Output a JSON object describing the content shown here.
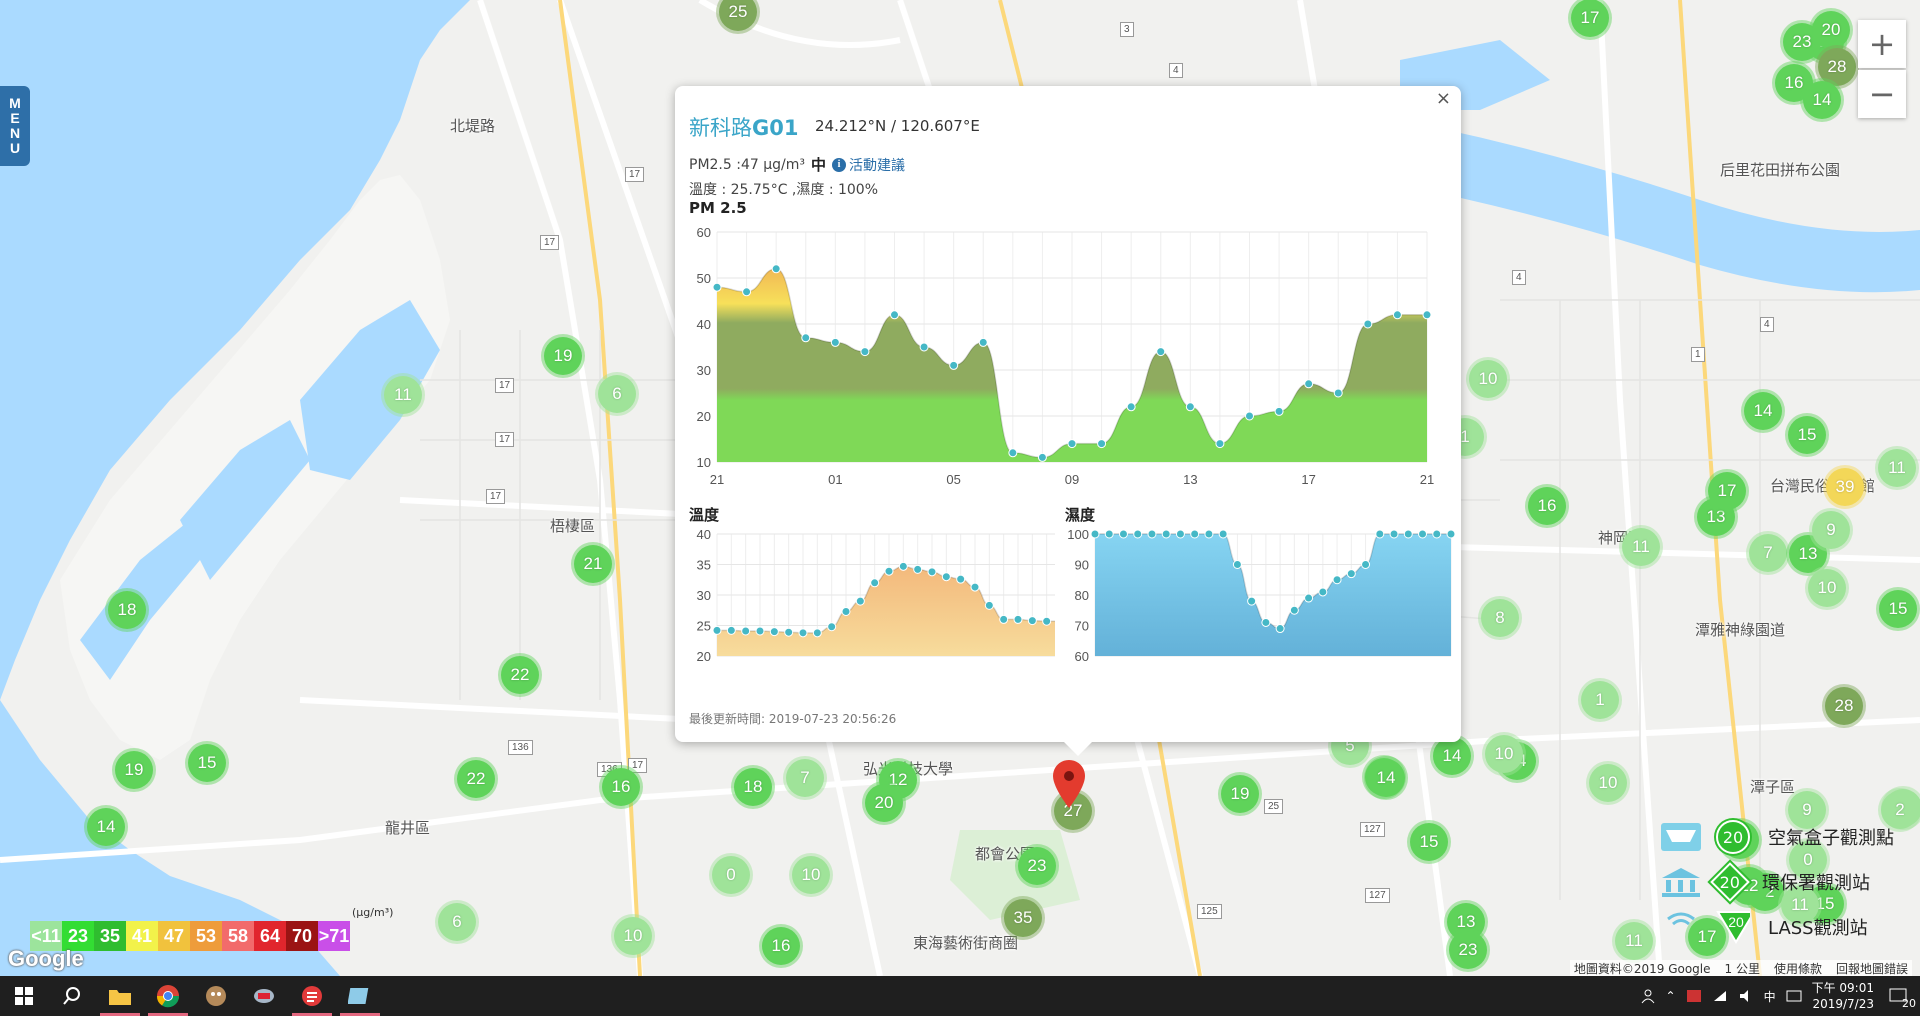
{
  "popup": {
    "station_name_prefix": "新科路",
    "station_name_code": "G01",
    "coords": "24.212°N / 120.607°E",
    "close": "×",
    "pm_reading": "PM2.5 :47 μg/m³",
    "pm_level": "中",
    "advice_link": "活動建議",
    "info_glyph": "i",
    "temp_humidity": "溫度 : 25.75°C ,濕度 : 100%",
    "pm_chart_title": "PM 2.5",
    "temp_chart_title": "溫度",
    "hum_chart_title": "濕度",
    "last_updated": "最後更新時間: 2019-07-23 20:56:26"
  },
  "chart_data": [
    {
      "type": "area",
      "title": "PM 2.5",
      "x_ticks": [
        "21",
        "01",
        "05",
        "09",
        "13",
        "17",
        "21"
      ],
      "ylim": [
        10,
        60
      ],
      "y_ticks": [
        10,
        20,
        30,
        40,
        50,
        60
      ],
      "values": [
        48,
        47,
        52,
        37,
        36,
        34,
        42,
        35,
        31,
        36,
        12,
        11,
        14,
        14,
        22,
        34,
        22,
        14,
        20,
        21,
        27,
        25,
        40,
        42,
        42
      ],
      "grid": true
    },
    {
      "type": "area",
      "title": "溫度",
      "ylim": [
        20,
        40
      ],
      "y_ticks": [
        20,
        25,
        30,
        35,
        40
      ],
      "values": [
        24.2,
        24.2,
        24.1,
        24.1,
        24.0,
        23.9,
        23.8,
        23.8,
        24.8,
        27.3,
        29.0,
        32.0,
        33.9,
        34.7,
        34.2,
        33.8,
        33.0,
        32.6,
        31.3,
        28.3,
        26.0,
        26.0,
        25.8,
        25.7,
        25.7
      ],
      "grid": true
    },
    {
      "type": "area",
      "title": "濕度",
      "ylim": [
        60,
        100
      ],
      "y_ticks": [
        60,
        70,
        80,
        90,
        100
      ],
      "values": [
        100,
        100,
        100,
        100,
        100,
        100,
        100,
        100,
        100,
        100,
        90,
        78,
        71,
        69,
        75,
        79,
        81,
        85,
        87,
        90,
        100,
        100,
        100,
        100,
        100,
        100
      ],
      "grid": true
    }
  ],
  "menu_tab": [
    "M",
    "E",
    "N",
    "U"
  ],
  "zoom": {
    "in": "+",
    "out": "−"
  },
  "legend": {
    "unit": "(μg/m³)",
    "cells": [
      {
        "label": "<11",
        "color": "#9ce49c"
      },
      {
        "label": "23",
        "color": "#33dd33"
      },
      {
        "label": "35",
        "color": "#2fbd2f"
      },
      {
        "label": "41",
        "color": "#f2f24a"
      },
      {
        "label": "47",
        "color": "#f1c23d"
      },
      {
        "label": "53",
        "color": "#ee9c3b"
      },
      {
        "label": "58",
        "color": "#f26b6b"
      },
      {
        "label": "64",
        "color": "#e1262d"
      },
      {
        "label": "70",
        "color": "#9b1414"
      },
      {
        "label": ">71",
        "color": "#c94fe8"
      }
    ],
    "station_types": [
      {
        "label": "空氣盒子觀測點",
        "marker": "20"
      },
      {
        "label": "環保署觀測站",
        "marker": "20"
      },
      {
        "label": "LASS觀測站",
        "marker": "20"
      }
    ]
  },
  "map": {
    "google": "Google",
    "footer": [
      "地圖資料©2019 Google",
      "1 公里",
      "使用條款",
      "回報地圖錯誤"
    ],
    "places": [
      {
        "label": "梧棲區"
      },
      {
        "label": "龍井區"
      },
      {
        "label": "神岡區"
      },
      {
        "label": "潭子區"
      },
      {
        "label": "都會公園"
      },
      {
        "label": "東海藝術街商圈"
      },
      {
        "label": "弘光科技大學"
      },
      {
        "label": "后里花田拼布公園"
      },
      {
        "label": "潭雅神綠園道"
      },
      {
        "label": "台灣民俗文物館"
      },
      {
        "label": "北堤路"
      }
    ],
    "markers": [
      "25",
      "17",
      "17",
      "23",
      "20",
      "28",
      "16",
      "14",
      "19",
      "11",
      "6",
      "21",
      "18",
      "22",
      "19",
      "15",
      "14",
      "22",
      "16",
      "18",
      "7",
      "12",
      "20",
      "0",
      "10",
      "23",
      "35",
      "16",
      "6",
      "10",
      "27",
      "10",
      "14",
      "15",
      "16",
      "11",
      "13",
      "17",
      "7",
      "13",
      "9",
      "10",
      "8",
      "39",
      "11",
      "15",
      "28",
      "14",
      "14",
      "10",
      "19",
      "15",
      "13",
      "23",
      "11",
      "17",
      "12",
      "15",
      "9",
      "8",
      "12",
      "2",
      "0",
      "11",
      "5",
      "10",
      "14",
      "14",
      "20",
      "1",
      "1"
    ],
    "shields": [
      "17",
      "17",
      "17",
      "12",
      "136",
      "136",
      "17",
      "17",
      "127",
      "127",
      "125",
      "4",
      "4",
      "4",
      "1",
      "25",
      "3",
      "17"
    ]
  },
  "taskbar": {
    "clock_time": "下午 09:01",
    "clock_date": "2019/7/23",
    "tray_ime": "中",
    "notif_count": "20"
  }
}
